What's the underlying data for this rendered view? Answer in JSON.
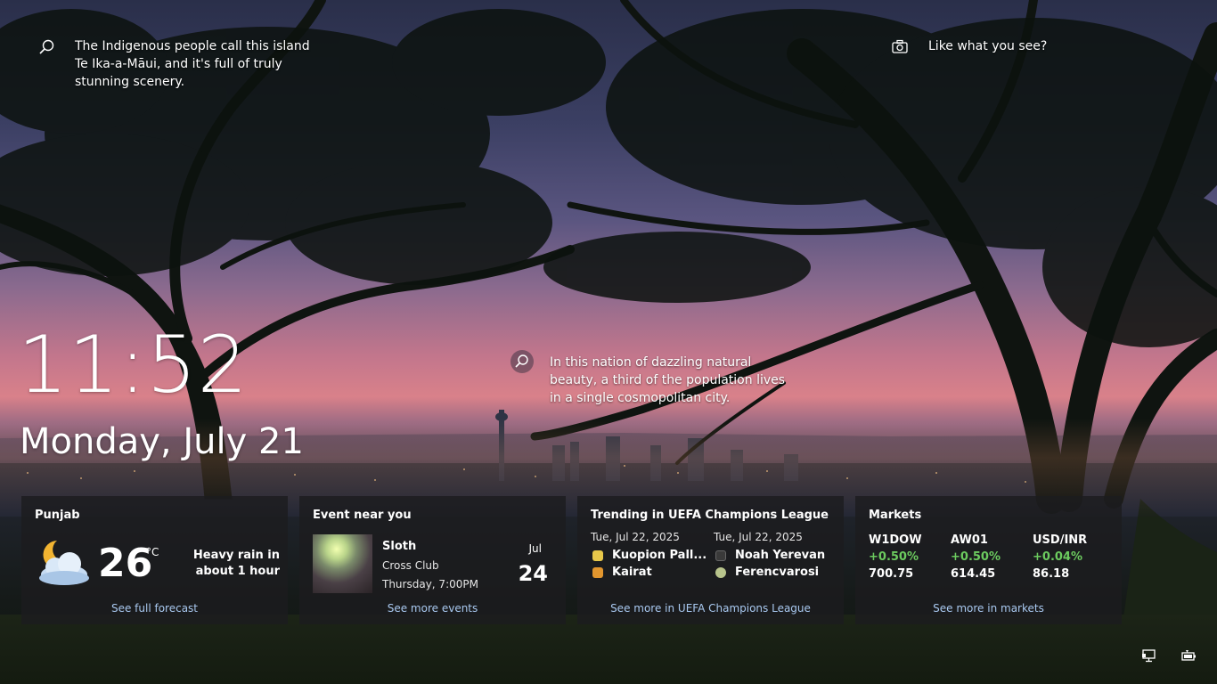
{
  "spotlight": {
    "hint_1": "The Indigenous people call this island Te Ika-a-Māui, and it's full of truly stunning scenery.",
    "hint_2": "In this nation of dazzling natural beauty, a third of the population lives in a single cosmopolitan city.",
    "like_label": "Like what you see?"
  },
  "lock": {
    "time": "11:52",
    "date": "Monday, July 21"
  },
  "weather": {
    "location": "Punjab",
    "temperature": "26",
    "unit": "°C",
    "condition": "Heavy rain in about 1 hour",
    "link": "See full forecast",
    "icon": "partly-cloudy-night-icon"
  },
  "event": {
    "title": "Event near you",
    "name": "Sloth",
    "venue": "Cross Club",
    "time": "Thursday, 7:00PM",
    "month": "Jul",
    "day": "24",
    "link": "See more events"
  },
  "sports": {
    "title": "Trending in UEFA Champions League",
    "matches": [
      {
        "date": "Tue, Jul 22, 2025",
        "team_a": "Kuopion Pall...",
        "team_b": "Kairat"
      },
      {
        "date": "Tue, Jul 22, 2025",
        "team_a": "Noah Yerevan",
        "team_b": "Ferencvarosi"
      }
    ],
    "link": "See more in UEFA Champions League"
  },
  "markets": {
    "title": "Markets",
    "items": [
      {
        "symbol": "W1DOW",
        "change": "+0.50%",
        "value": "700.75"
      },
      {
        "symbol": "AW01",
        "change": "+0.50%",
        "value": "614.45"
      },
      {
        "symbol": "USD/INR",
        "change": "+0.04%",
        "value": "86.18"
      }
    ],
    "link": "See more in markets"
  },
  "tray": {
    "icons": [
      "network-icon",
      "battery-icon"
    ]
  },
  "colors": {
    "card_bg": "#1c1c1e",
    "link": "#a9c9f0",
    "positive": "#6ccb5f"
  }
}
